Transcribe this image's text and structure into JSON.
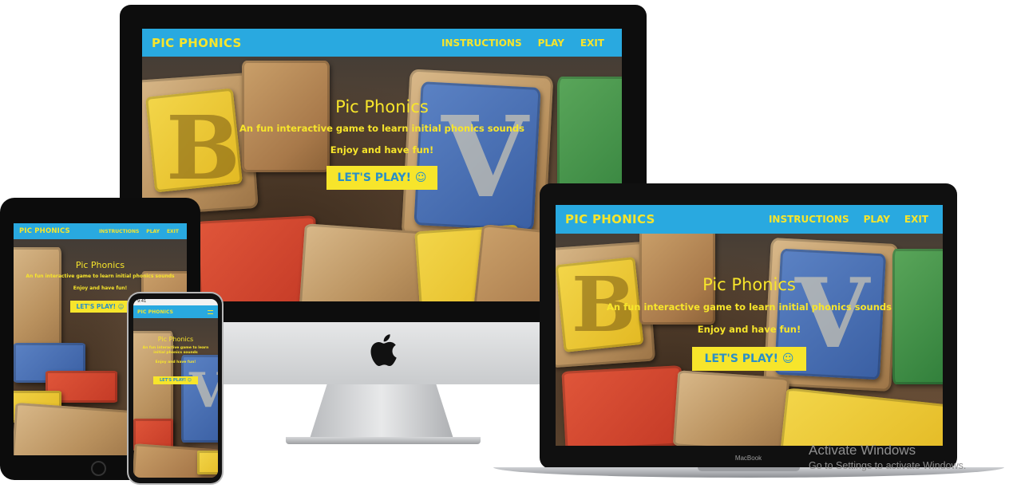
{
  "site": {
    "brand": "PIC PHONICS",
    "nav": [
      "INSTRUCTIONS",
      "PLAY",
      "EXIT"
    ],
    "title": "Pic Phonics",
    "subtitle": "An fun interactive game to learn initial phonics sounds",
    "tagline": "Enjoy and have fun!",
    "play_button": "LET'S PLAY! ☺"
  },
  "phone": {
    "status_time": "9:41"
  },
  "laptop": {
    "brand_label": "MacBook"
  },
  "watermark": {
    "line1": "Activate Windows",
    "line2": "Go to Settings to activate Windows."
  },
  "colors": {
    "navbar": "#29a9e0",
    "accent_yellow": "#f7e52b",
    "button_text": "#2a8fc7"
  },
  "icons": {
    "logo": "apple-logo-icon"
  }
}
